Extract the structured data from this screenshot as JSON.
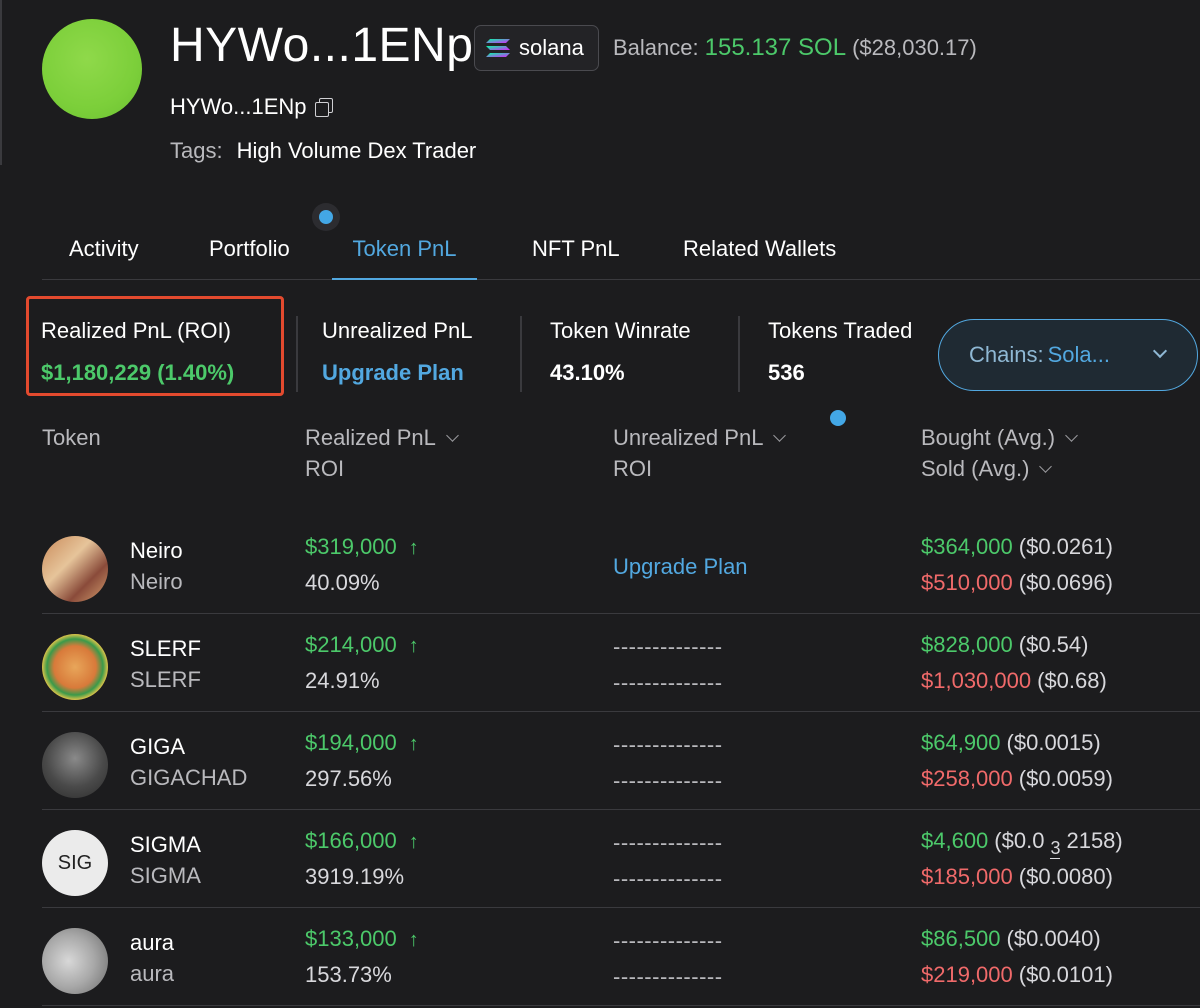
{
  "header": {
    "wallet_title": "HYWo...1ENp",
    "chain": "solana",
    "balance_label": "Balance:",
    "balance_sol": "155.137 SOL",
    "balance_usd": "($28,030.17)",
    "address": "HYWo...1ENp",
    "tags_label": "Tags:",
    "tag": "High Volume Dex Trader"
  },
  "tabs": [
    {
      "label": "Activity"
    },
    {
      "label": "Portfolio"
    },
    {
      "label": "Token PnL"
    },
    {
      "label": "NFT PnL"
    },
    {
      "label": "Related Wallets"
    }
  ],
  "active_tab": "Token PnL",
  "stats": {
    "realized": {
      "label": "Realized PnL (ROI)",
      "value": "$1,180,229 (1.40%)"
    },
    "unrealized": {
      "label": "Unrealized PnL",
      "value": "Upgrade Plan"
    },
    "winrate": {
      "label": "Token Winrate",
      "value": "43.10%"
    },
    "traded": {
      "label": "Tokens Traded",
      "value": "536"
    }
  },
  "chains_filter": {
    "label": "Chains:",
    "value": "Sola..."
  },
  "table": {
    "headers": {
      "token": "Token",
      "realized": "Realized PnL",
      "realized_sub": "ROI",
      "unrealized": "Unrealized PnL",
      "unrealized_sub": "ROI",
      "bought": "Bought (Avg.)",
      "sold": "Sold (Avg.)"
    },
    "rows": [
      {
        "symbol": "Neiro",
        "name": "Neiro",
        "pnl": "$319,000",
        "roi": "40.09%",
        "unreal_1": "Upgrade Plan",
        "unreal_2": "",
        "bought": "$364,000",
        "bought_avg": "($0.0261)",
        "sold": "$510,000",
        "sold_avg": "($0.0696)"
      },
      {
        "symbol": "SLERF",
        "name": "SLERF",
        "pnl": "$214,000",
        "roi": "24.91%",
        "unreal_1": "--------------",
        "unreal_2": "--------------",
        "bought": "$828,000",
        "bought_avg": "($0.54)",
        "sold": "$1,030,000",
        "sold_avg": "($0.68)"
      },
      {
        "symbol": "GIGA",
        "name": "GIGACHAD",
        "pnl": "$194,000",
        "roi": "297.56%",
        "unreal_1": "--------------",
        "unreal_2": "--------------",
        "bought": "$64,900",
        "bought_avg": "($0.0015)",
        "sold": "$258,000",
        "sold_avg": "($0.0059)"
      },
      {
        "symbol": "SIGMA",
        "name": "SIGMA",
        "icon_text": "SIG",
        "pnl": "$166,000",
        "roi": "3919.19%",
        "unreal_1": "--------------",
        "unreal_2": "--------------",
        "bought": "$4,600",
        "bought_avg_prefix": "($0.0",
        "bought_avg_zeros": "3",
        "bought_avg_suffix": "2158)",
        "sold": "$185,000",
        "sold_avg": "($0.0080)"
      },
      {
        "symbol": "aura",
        "name": "aura",
        "pnl": "$133,000",
        "roi": "153.73%",
        "unreal_1": "--------------",
        "unreal_2": "--------------",
        "bought": "$86,500",
        "bought_avg": "($0.0040)",
        "sold": "$219,000",
        "sold_avg": "($0.0101)"
      }
    ],
    "arrow": "↑"
  },
  "colors": {
    "positive": "#4cc96a",
    "negative": "#f06a6a",
    "accent": "#52a8e0",
    "highlight": "#e34a2e",
    "background": "#1c1c1e"
  }
}
